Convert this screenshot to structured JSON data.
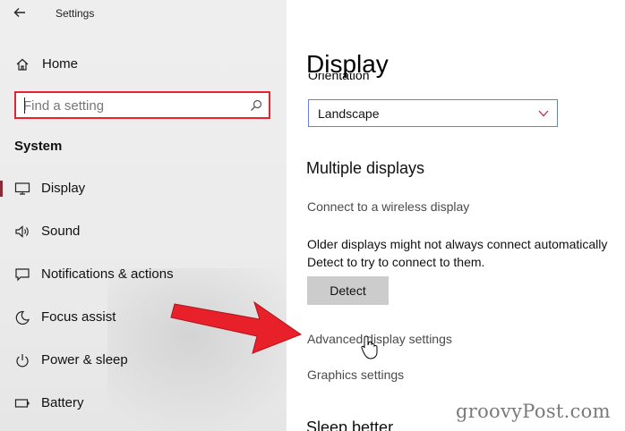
{
  "app": {
    "title": "Settings"
  },
  "sidebar": {
    "home_label": "Home",
    "search_placeholder": "Find a setting",
    "section_title": "System",
    "items": [
      {
        "label": "Display",
        "icon": "monitor-icon",
        "selected": true
      },
      {
        "label": "Sound",
        "icon": "speaker-icon"
      },
      {
        "label": "Notifications & actions",
        "icon": "notification-icon"
      },
      {
        "label": "Focus assist",
        "icon": "moon-icon"
      },
      {
        "label": "Power & sleep",
        "icon": "power-icon"
      },
      {
        "label": "Battery",
        "icon": "battery-icon"
      }
    ]
  },
  "main": {
    "title": "Display",
    "orientation_label": "Orientation",
    "orientation_value": "Landscape",
    "multiple_displays_heading": "Multiple displays",
    "wireless_link": "Connect to a wireless display",
    "detect_text_line1": "Older displays might not always connect automatically",
    "detect_text_line2": "Detect to try to connect to them.",
    "detect_button": "Detect",
    "advanced_link": "Advanced display settings",
    "graphics_link": "Graphics settings",
    "sleep_heading": "Sleep better"
  },
  "overlay": {
    "watermark": "groovyPost.com",
    "arrow_color": "#e8202a"
  },
  "colors": {
    "accent": "#8a2b3a",
    "search_border": "#e8222e",
    "dropdown_border": "#6d7cd6",
    "link": "#4a4a4a"
  }
}
